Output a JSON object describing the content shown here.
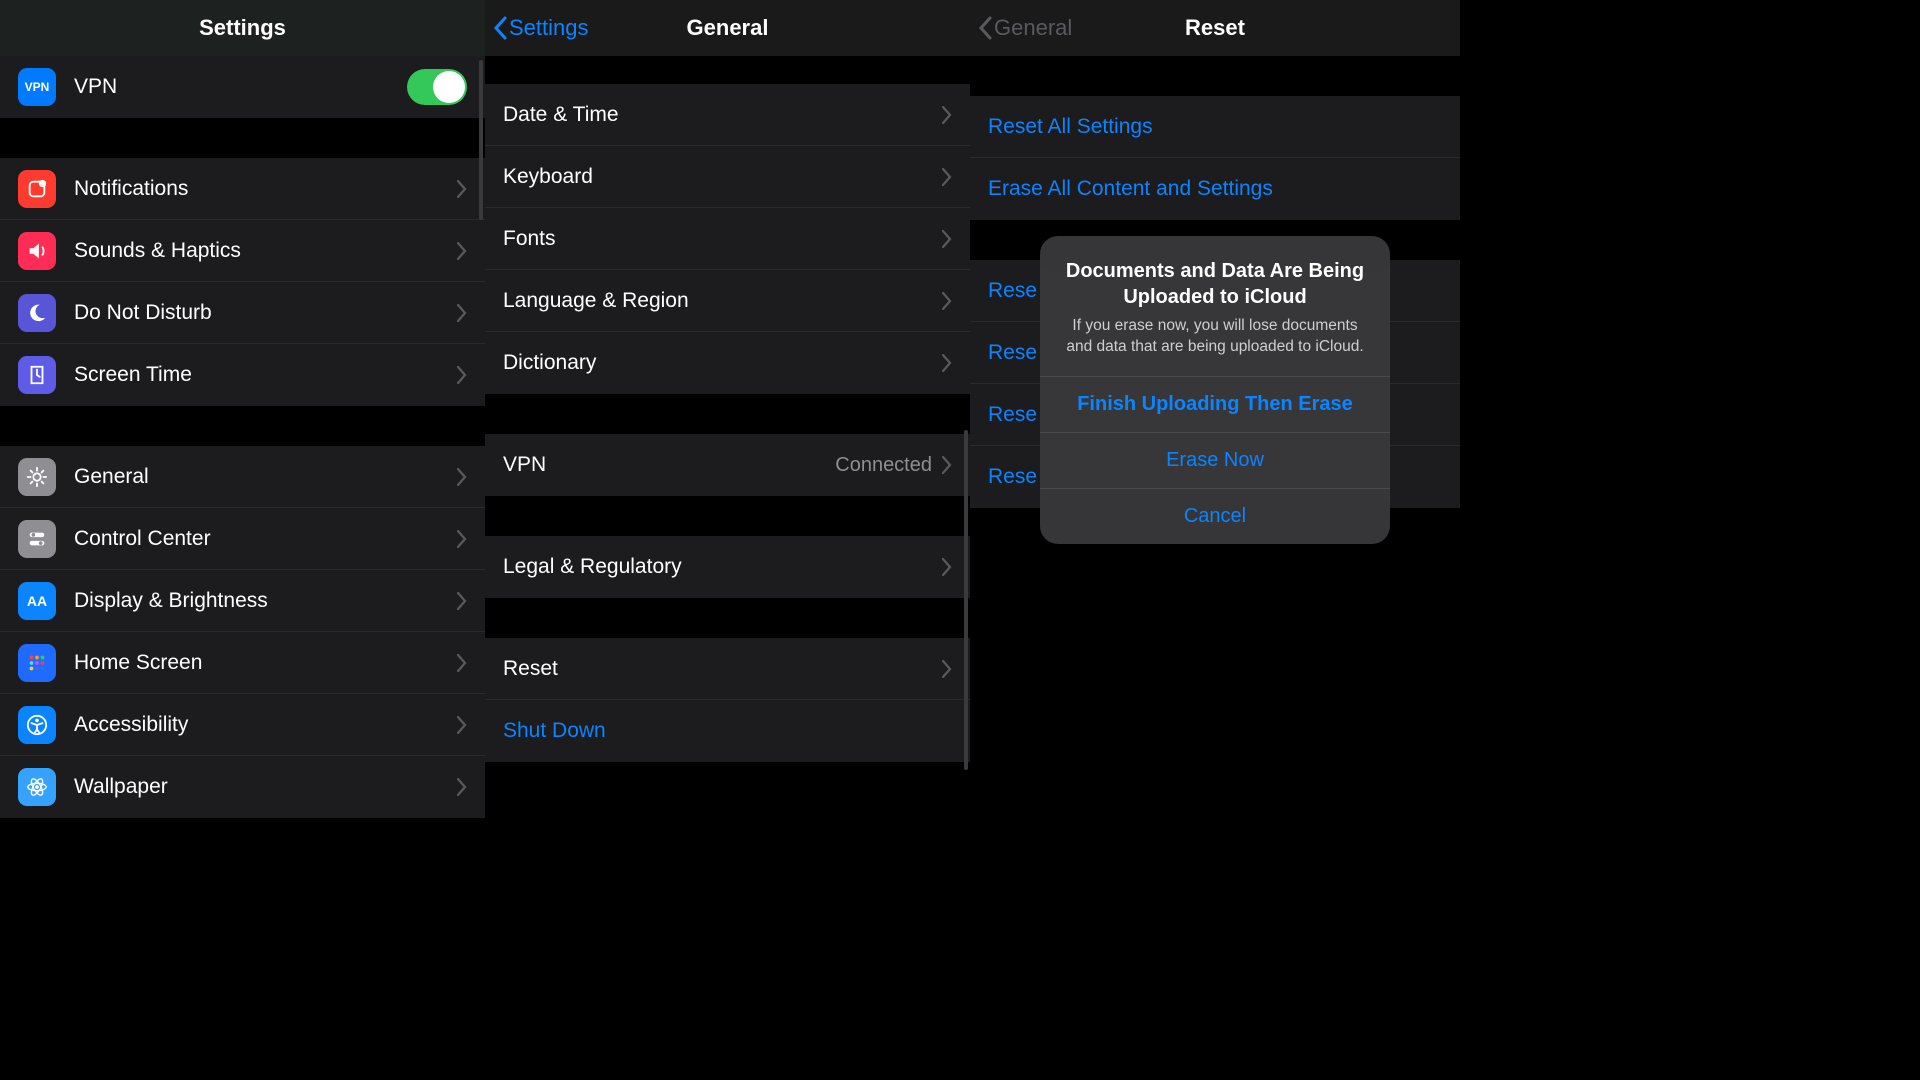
{
  "panel1": {
    "title": "Settings",
    "vpn_row": {
      "label": "VPN",
      "icon_text": "VPN"
    },
    "group2": [
      {
        "key": "notifications",
        "label": "Notifications"
      },
      {
        "key": "sounds-haptics",
        "label": "Sounds & Haptics"
      },
      {
        "key": "do-not-disturb",
        "label": "Do Not Disturb"
      },
      {
        "key": "screen-time",
        "label": "Screen Time"
      }
    ],
    "group3": [
      {
        "key": "general",
        "label": "General"
      },
      {
        "key": "control-center",
        "label": "Control Center"
      },
      {
        "key": "display",
        "label": "Display & Brightness"
      },
      {
        "key": "home-screen",
        "label": "Home Screen"
      },
      {
        "key": "accessibility",
        "label": "Accessibility"
      },
      {
        "key": "wallpaper",
        "label": "Wallpaper"
      }
    ]
  },
  "panel2": {
    "back": "Settings",
    "title": "General",
    "group1": [
      {
        "key": "date-time",
        "label": "Date & Time"
      },
      {
        "key": "keyboard",
        "label": "Keyboard"
      },
      {
        "key": "fonts",
        "label": "Fonts"
      },
      {
        "key": "language-region",
        "label": "Language & Region"
      },
      {
        "key": "dictionary",
        "label": "Dictionary"
      }
    ],
    "vpn": {
      "label": "VPN",
      "value": "Connected"
    },
    "legal": {
      "label": "Legal & Regulatory"
    },
    "reset": {
      "label": "Reset"
    },
    "shutdown": {
      "label": "Shut Down"
    }
  },
  "panel3": {
    "back": "General",
    "title": "Reset",
    "group1": [
      {
        "key": "reset-all-settings",
        "label": "Reset All Settings"
      },
      {
        "key": "erase-all",
        "label": "Erase All Content and Settings"
      }
    ],
    "group2_prefix": "Rese",
    "alert": {
      "title": "Documents and Data Are Being Uploaded to iCloud",
      "message": "If you erase now, you will lose documents and data that are being uploaded to iCloud.",
      "primary": "Finish Uploading Then Erase",
      "secondary": "Erase Now",
      "cancel": "Cancel"
    }
  }
}
